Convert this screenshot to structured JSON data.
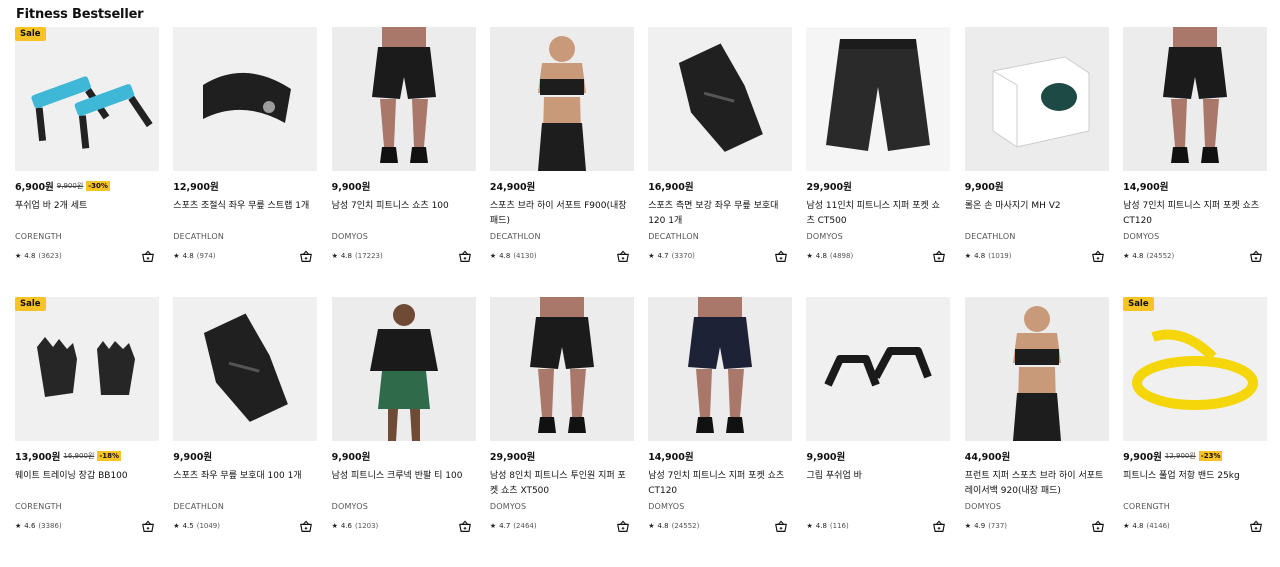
{
  "section": {
    "title": "Fitness Bestseller"
  },
  "products": [
    {
      "price": "6,900원",
      "old_price": "9,900원",
      "discount": "-30%",
      "sale": "Sale",
      "name": "푸쉬업 바 2개 세트",
      "brand": "CORENGTH",
      "rating": "4.8",
      "reviews": "(3623)",
      "icon": "pushup-bars"
    },
    {
      "price": "12,900원",
      "name": "스포츠 조절식 좌우 무릎 스트랩 1개",
      "brand": "DECATHLON",
      "rating": "4.8",
      "reviews": "(974)",
      "icon": "knee-strap"
    },
    {
      "price": "9,900원",
      "name": "남성 7인치 피트니스 쇼츠 100",
      "brand": "DOMYOS",
      "rating": "4.8",
      "reviews": "(17223)",
      "icon": "shorts-model"
    },
    {
      "price": "24,900원",
      "name": "스포츠 브라 하이 서포트 F900(내장 패드)",
      "brand": "DECATHLON",
      "rating": "4.8",
      "reviews": "(4130)",
      "icon": "sports-bra-model"
    },
    {
      "price": "16,900원",
      "name": "스포츠 측면 보강 좌우 무릎 보호대 120 1개",
      "brand": "DECATHLON",
      "rating": "4.7",
      "reviews": "(3370)",
      "icon": "knee-sleeve"
    },
    {
      "price": "29,900원",
      "name": "남성 11인치 피트니스 지퍼 포켓 쇼츠 CT500",
      "brand": "DOMYOS",
      "rating": "4.8",
      "reviews": "(4898)",
      "icon": "shorts"
    },
    {
      "price": "9,900원",
      "name": "롤온 손 마사지기 MH V2",
      "brand": "DECATHLON",
      "rating": "4.8",
      "reviews": "(1019)",
      "icon": "massager-box"
    },
    {
      "price": "14,900원",
      "name": "남성 7인치 피트니스 지퍼 포켓 쇼츠 CT120",
      "brand": "DOMYOS",
      "rating": "4.8",
      "reviews": "(24552)",
      "icon": "shorts-model"
    },
    {
      "price": "13,900원",
      "old_price": "16,900원",
      "discount": "-18%",
      "sale": "Sale",
      "name": "웨이트 트레이닝 장갑 BB100",
      "brand": "CORENGTH",
      "rating": "4.6",
      "reviews": "(3386)",
      "icon": "gloves"
    },
    {
      "price": "9,900원",
      "name": "스포츠 좌우 무릎 보호대 100 1개",
      "brand": "DECATHLON",
      "rating": "4.5",
      "reviews": "(1049)",
      "icon": "knee-sleeve"
    },
    {
      "price": "9,900원",
      "name": "남성 피트니스 크루넥 반팔 티 100",
      "brand": "DOMYOS",
      "rating": "4.6",
      "reviews": "(1203)",
      "icon": "tshirt-model"
    },
    {
      "price": "29,900원",
      "name": "남성 8인치 피트니스 투인원 지퍼 포켓 쇼츠 XT500",
      "brand": "DOMYOS",
      "rating": "4.7",
      "reviews": "(2464)",
      "icon": "shorts-model"
    },
    {
      "price": "14,900원",
      "name": "남성 7인치 피트니스 지퍼 포켓 쇼츠 CT120",
      "brand": "DOMYOS",
      "rating": "4.8",
      "reviews": "(24552)",
      "icon": "shorts-model-navy"
    },
    {
      "price": "9,900원",
      "name": "그립 푸쉬업 바",
      "brand": "",
      "rating": "4.8",
      "reviews": "(116)",
      "icon": "pushup-bars-black"
    },
    {
      "price": "44,900원",
      "name": "프런트 지퍼 스포츠 브라 하이 서포트 레이서백 920(내장 패드)",
      "brand": "DOMYOS",
      "rating": "4.9",
      "reviews": "(737)",
      "icon": "sports-bra-model"
    },
    {
      "price": "9,900원",
      "old_price": "12,900원",
      "discount": "-23%",
      "sale": "Sale",
      "name": "피트니스 풀업 저항 밴드 25kg",
      "brand": "CORENGTH",
      "rating": "4.8",
      "reviews": "(4146)",
      "icon": "resistance-band"
    }
  ],
  "labels": {
    "star": "★"
  }
}
